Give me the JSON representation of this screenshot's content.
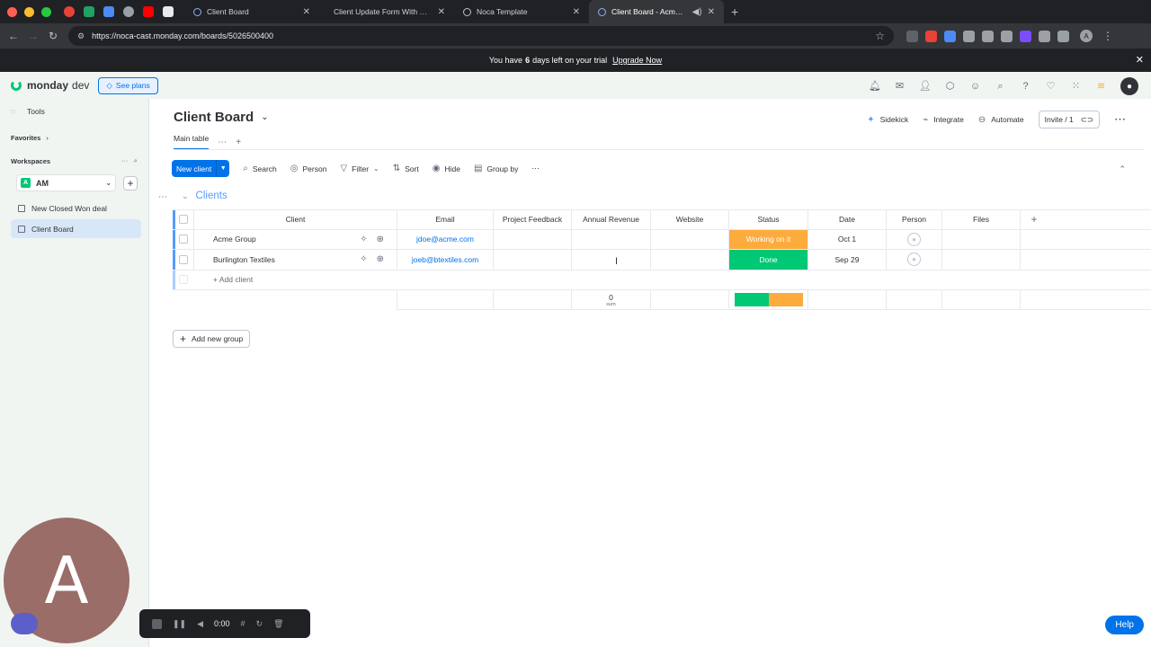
{
  "browser": {
    "tabs": [
      {
        "title": "Client Board"
      },
      {
        "title": "Client Update Form With Mon"
      },
      {
        "title": "Noca Template"
      },
      {
        "title": "Client Board - Acme Grou"
      }
    ],
    "url": "https://noca-cast.monday.com/boards/5026500400"
  },
  "trial": {
    "prefix": "You have",
    "days": "6",
    "suffix": "days left on your trial",
    "upgrade": "Upgrade Now"
  },
  "header": {
    "brand": "monday",
    "product": "dev",
    "see_plans": "See plans",
    "user_initial": "A"
  },
  "sidebar": {
    "tools": "Tools",
    "favorites": "Favorites",
    "workspaces": "Workspaces",
    "workspace_badge": "A",
    "workspace_name": "AM",
    "boards": [
      "New Closed Won deal",
      "Client Board"
    ]
  },
  "board": {
    "title": "Client Board",
    "view_tab": "Main table",
    "actions": {
      "sidekick": "Sidekick",
      "integrate": "Integrate",
      "automate": "Automate",
      "invite": "Invite / 1"
    },
    "toolbar": {
      "new_item": "New client",
      "search": "Search",
      "person": "Person",
      "filter": "Filter",
      "sort": "Sort",
      "hide": "Hide",
      "group_by": "Group by"
    }
  },
  "group": {
    "title": "Clients",
    "columns": {
      "client": "Client",
      "email": "Email",
      "feedback": "Project Feedback",
      "revenue": "Annual Revenue",
      "website": "Website",
      "status": "Status",
      "date": "Date",
      "person": "Person",
      "files": "Files"
    },
    "rows": [
      {
        "client": "Acme Group",
        "email": "jdoe@acme.com",
        "status": "Working on it",
        "date": "Oct 1"
      },
      {
        "client": "Burlington Textiles",
        "email": "joeb@btextiles.com",
        "status": "Done",
        "date": "Sep 29"
      }
    ],
    "add_item": "+ Add client",
    "summary": {
      "revenue_value": "0",
      "revenue_label": "sum"
    }
  },
  "add_group": "Add new group",
  "recording": {
    "initial": "A",
    "time": "0:00"
  },
  "help": "Help",
  "colors": {
    "primary": "#0073ea",
    "done": "#00c875",
    "working": "#fdab3d",
    "group": "#579bfc"
  }
}
